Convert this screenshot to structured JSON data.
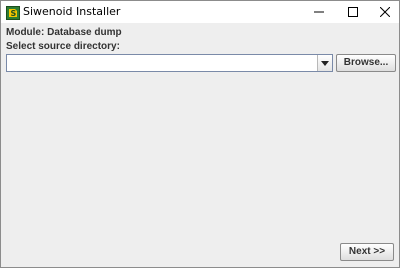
{
  "window": {
    "title": "Siwenoid Installer",
    "icon": "installer-app-icon",
    "controls": [
      "minimize-icon",
      "maximize-icon",
      "close-icon"
    ]
  },
  "form": {
    "module_label": "Module: Database dump",
    "select_label": "Select source directory:",
    "source_directory_value": "",
    "browse_label": "Browse..."
  },
  "footer": {
    "next_label": "Next >>"
  }
}
